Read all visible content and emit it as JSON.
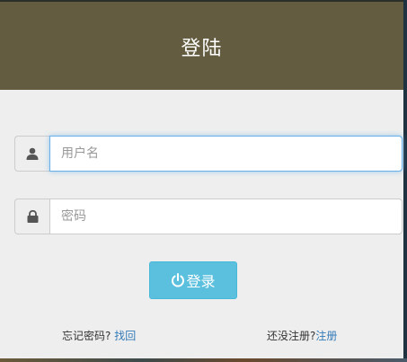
{
  "header": {
    "title": "登陆"
  },
  "form": {
    "username": {
      "placeholder": "用户名",
      "value": ""
    },
    "password": {
      "placeholder": "密码",
      "value": ""
    },
    "submit_label": "登录"
  },
  "footer": {
    "forgot_text": "忘记密码?",
    "forgot_link": "找回",
    "register_text": "还没注册?",
    "register_link": "注册"
  },
  "icons": {
    "username": "user-icon",
    "password": "lock-icon",
    "submit": "power-icon"
  },
  "colors": {
    "header_bg": "#645c40",
    "panel_bg": "#eeeeee",
    "button_bg": "#5bc0de",
    "link": "#337ab7",
    "focus_border": "#66afe9"
  }
}
